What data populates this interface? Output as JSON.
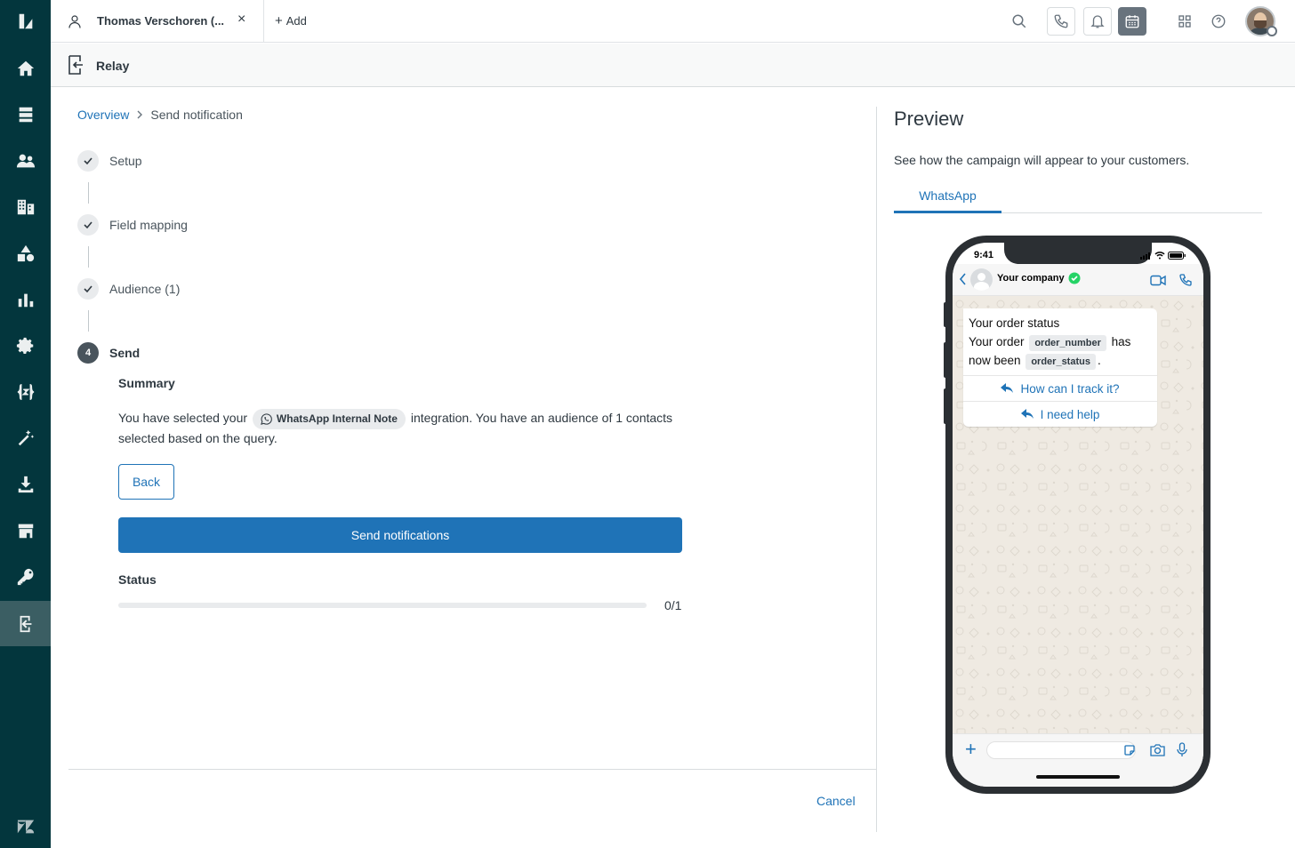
{
  "topbar": {
    "tab_title": "Thomas Verschoren (...",
    "tab_close": "×",
    "add_label": "Add"
  },
  "appbar": {
    "title": "Relay"
  },
  "breadcrumb": {
    "overview": "Overview",
    "current": "Send notification"
  },
  "steps": [
    {
      "label": "Setup",
      "state": "done"
    },
    {
      "label": "Field mapping",
      "state": "done"
    },
    {
      "label": "Audience (1)",
      "state": "done"
    },
    {
      "label": "Send",
      "state": "current",
      "number": "4"
    }
  ],
  "summary": {
    "title": "Summary",
    "text_before": "You have selected your",
    "integration": "WhatsApp Internal Note",
    "text_after": "integration. You have an audience of 1 contacts selected based on the query."
  },
  "actions": {
    "back": "Back",
    "send": "Send notifications",
    "cancel": "Cancel"
  },
  "status": {
    "title": "Status",
    "count": "0/1",
    "progress_fraction": 0
  },
  "preview": {
    "title": "Preview",
    "description": "See how the campaign will appear to your customers.",
    "tab": "WhatsApp",
    "phone": {
      "time": "9:41",
      "contact_name": "Your company",
      "message_title": "Your order status",
      "message_prefix": "Your order",
      "var_order_number": "order_number",
      "message_middle": "has now been",
      "var_order_status": "order_status",
      "message_suffix": ".",
      "reply_1": "How can I track it?",
      "reply_2": "I need help"
    }
  },
  "colors": {
    "nav_bg": "#03363d",
    "primary": "#1f73b7",
    "whatsapp_green": "#25d366"
  }
}
